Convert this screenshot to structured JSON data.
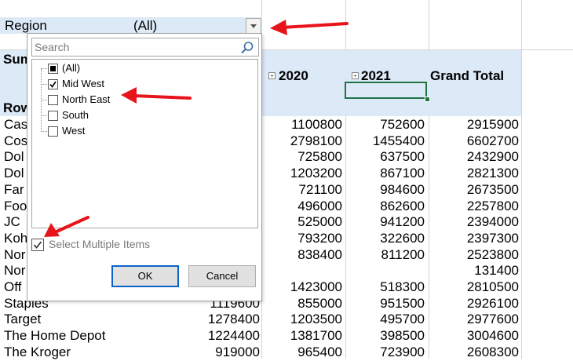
{
  "filter": {
    "label": "Region",
    "value": "(All)"
  },
  "pivot": {
    "sum_label": "Sum",
    "rows_label": "Row",
    "col_headers": [
      "2020",
      "2021",
      "Grand Total"
    ],
    "rows": [
      {
        "label": "Cas",
        "c2019": "",
        "c2020": "1100800",
        "c2021": "752600",
        "total": "2915900"
      },
      {
        "label": "Cos",
        "c2019": "",
        "c2020": "2798100",
        "c2021": "1455400",
        "total": "6602700"
      },
      {
        "label": "Dol",
        "c2019": "",
        "c2020": "725800",
        "c2021": "637500",
        "total": "2432900"
      },
      {
        "label": "Dol",
        "c2019": "",
        "c2020": "1203200",
        "c2021": "867100",
        "total": "2821300"
      },
      {
        "label": "Far",
        "c2019": "",
        "c2020": "721100",
        "c2021": "984600",
        "total": "2673500"
      },
      {
        "label": "Foo",
        "c2019": "",
        "c2020": "496000",
        "c2021": "862600",
        "total": "2257800"
      },
      {
        "label": "JC",
        "c2019": "",
        "c2020": "525000",
        "c2021": "941200",
        "total": "2394000"
      },
      {
        "label": "Koh",
        "c2019": "",
        "c2020": "793200",
        "c2021": "322600",
        "total": "2397300"
      },
      {
        "label": "Nor",
        "c2019": "",
        "c2020": "838400",
        "c2021": "811200",
        "total": "2523800"
      },
      {
        "label": "Nor",
        "c2019": "",
        "c2020": "",
        "c2021": "",
        "total": "131400"
      },
      {
        "label": "Off",
        "c2019": "",
        "c2020": "1423000",
        "c2021": "518300",
        "total": "2810500"
      },
      {
        "label": "Staples",
        "c2019": "1119600",
        "c2020": "855000",
        "c2021": "951500",
        "total": "2926100"
      },
      {
        "label": "Target",
        "c2019": "1278400",
        "c2020": "1203500",
        "c2021": "495700",
        "total": "2977600"
      },
      {
        "label": "The Home Depot",
        "c2019": "1224400",
        "c2020": "1381700",
        "c2021": "398500",
        "total": "3004600"
      },
      {
        "label": "The Kroger",
        "c2019": "919000",
        "c2020": "965400",
        "c2021": "723900",
        "total": "2608300"
      }
    ]
  },
  "dropdown": {
    "search_placeholder": "Search",
    "items": [
      {
        "label": "(All)",
        "state": "partial"
      },
      {
        "label": "Mid West",
        "state": "checked"
      },
      {
        "label": "North East",
        "state": "unchecked"
      },
      {
        "label": "South",
        "state": "unchecked"
      },
      {
        "label": "West",
        "state": "unchecked"
      }
    ],
    "select_multiple_label": "Select Multiple Items",
    "select_multiple_checked": true,
    "ok_label": "OK",
    "cancel_label": "Cancel"
  },
  "colors": {
    "header_band": "#dce9f6",
    "selection_border": "#217346",
    "arrow": "#e8141c",
    "ok_border": "#0a64c8"
  }
}
